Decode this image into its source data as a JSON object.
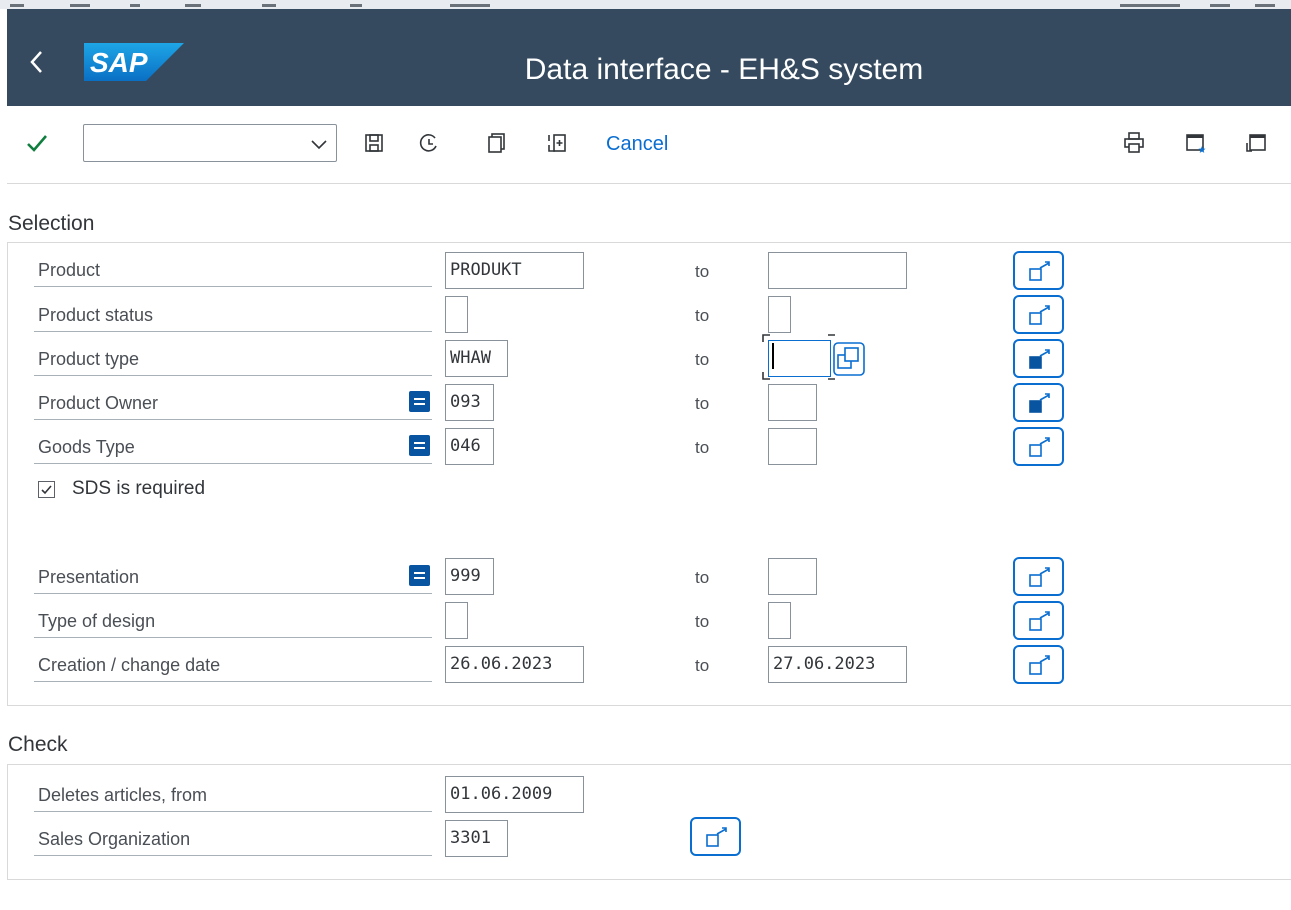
{
  "shell": {
    "title": "Data interface - EH&S system",
    "logo_text": "SAP",
    "header_color": "#354a5f"
  },
  "toolbar": {
    "cancel_label": "Cancel",
    "command_field_value": "",
    "icons": [
      "check-icon",
      "save-icon",
      "get-variant-icon",
      "copy-icon",
      "execute-background-icon",
      "print-icon",
      "new-session-icon",
      "customize-layout-icon"
    ]
  },
  "selection": {
    "title": "Selection",
    "to_label": "to",
    "rows": [
      {
        "label": "Product",
        "from": "PRODUKT",
        "to": "",
        "multi_active": false
      },
      {
        "label": "Product status",
        "from": "",
        "to": "",
        "multi_active": false
      },
      {
        "label": "Product type",
        "from": "WHAW",
        "to": "",
        "multi_active": true
      },
      {
        "label": "Product Owner",
        "from": "093",
        "to": "",
        "multi_active": true,
        "select_option": "equals"
      },
      {
        "label": "Goods Type",
        "from": "046",
        "to": "",
        "multi_active": false,
        "select_option": "equals"
      }
    ],
    "checkbox": {
      "label": "SDS is required",
      "checked": true
    },
    "rows2": [
      {
        "label": "Presentation",
        "from": "999",
        "to": "",
        "select_option": "equals"
      },
      {
        "label": "Type of design",
        "from": "",
        "to": ""
      },
      {
        "label": "Creation / change date",
        "from": "26.06.2023",
        "to": "27.06.2023"
      }
    ]
  },
  "check": {
    "title": "Check",
    "rows": [
      {
        "label": "Deletes articles, from",
        "value": "01.06.2009"
      },
      {
        "label": "Sales Organization",
        "value": "3301"
      }
    ]
  },
  "colors": {
    "accent": "#0a6ed1",
    "select_option_bg": "#0854a0",
    "check_green": "#107e3e"
  }
}
